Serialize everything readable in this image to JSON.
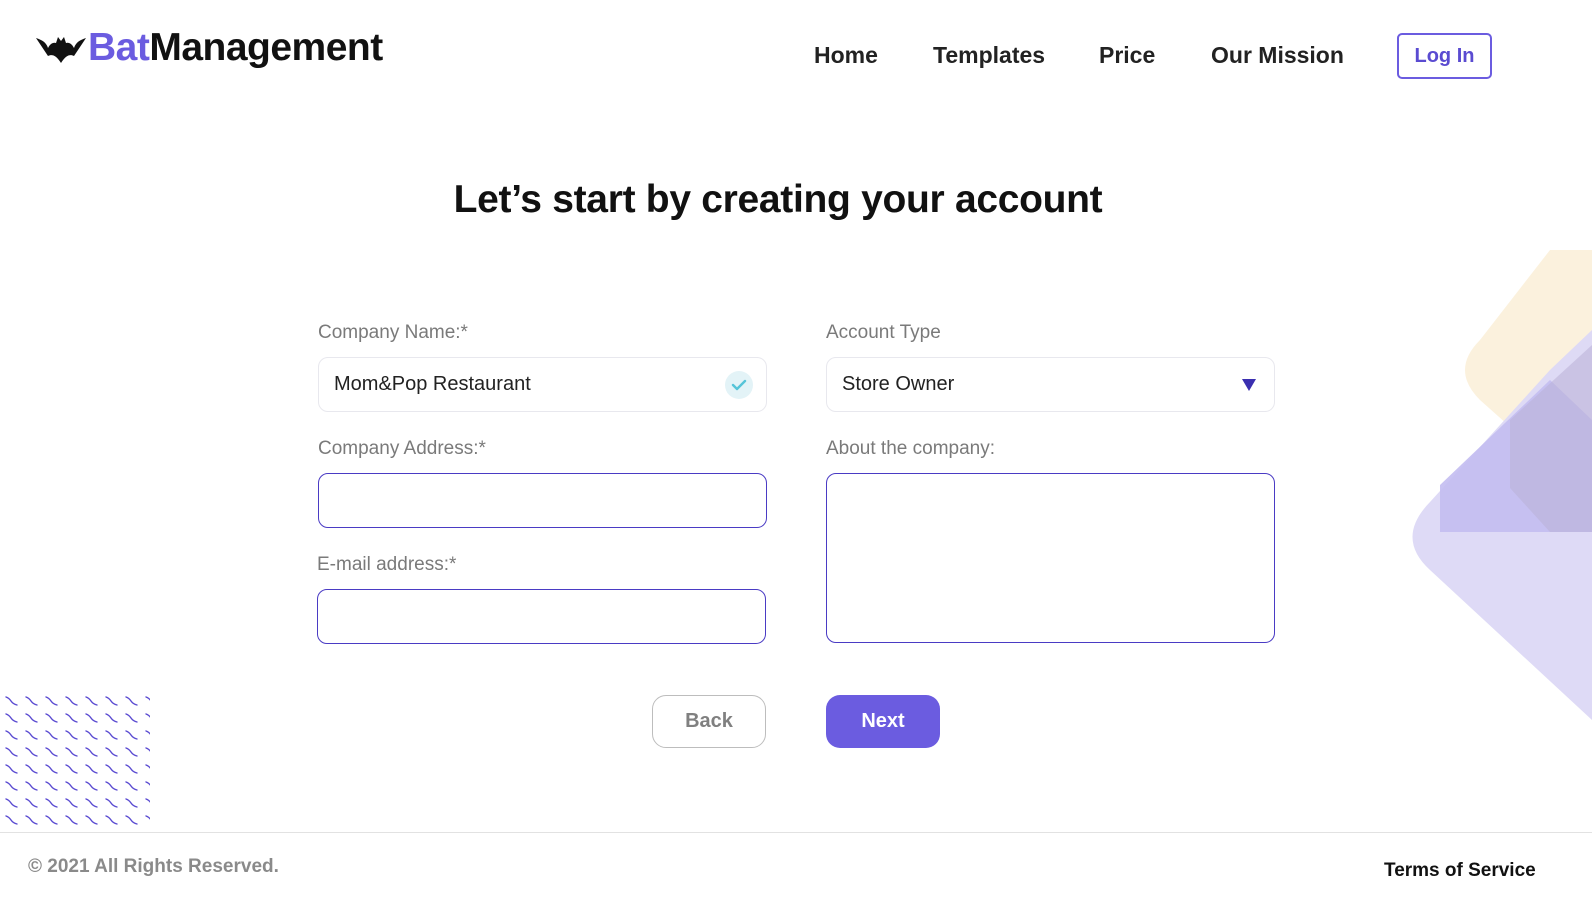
{
  "brand": {
    "name_part1": "Bat",
    "name_part2": "Management",
    "accent_color": "#6b5ce0",
    "logo_icon": "bat-icon"
  },
  "nav": {
    "items": [
      {
        "label": "Home"
      },
      {
        "label": "Templates"
      },
      {
        "label": "Price"
      },
      {
        "label": "Our Mission"
      }
    ],
    "login_label": "Log In"
  },
  "page": {
    "title": "Let’s start by creating your account"
  },
  "form": {
    "company_name": {
      "label": "Company Name:*",
      "value": "Mom&Pop Restaurant",
      "status_icon": "check-icon"
    },
    "account_type": {
      "label": "Account Type",
      "selected": "Store Owner",
      "icon": "caret-down-icon"
    },
    "company_address": {
      "label": "Company Address:*",
      "value": ""
    },
    "about": {
      "label": "About the company:",
      "value": ""
    },
    "email": {
      "label": "E-mail address:*",
      "value": ""
    },
    "back_label": "Back",
    "next_label": "Next"
  },
  "footer": {
    "copyright": "© 2021 All Rights Reserved.",
    "terms": "Terms of Service"
  },
  "colors": {
    "primary": "#6b5ce0",
    "input_border_active": "#4a3bc4",
    "deco_yellow": "#fbf1dd",
    "deco_lavender": "#dcd8f6",
    "deco_purple": "#c3bdf1"
  }
}
